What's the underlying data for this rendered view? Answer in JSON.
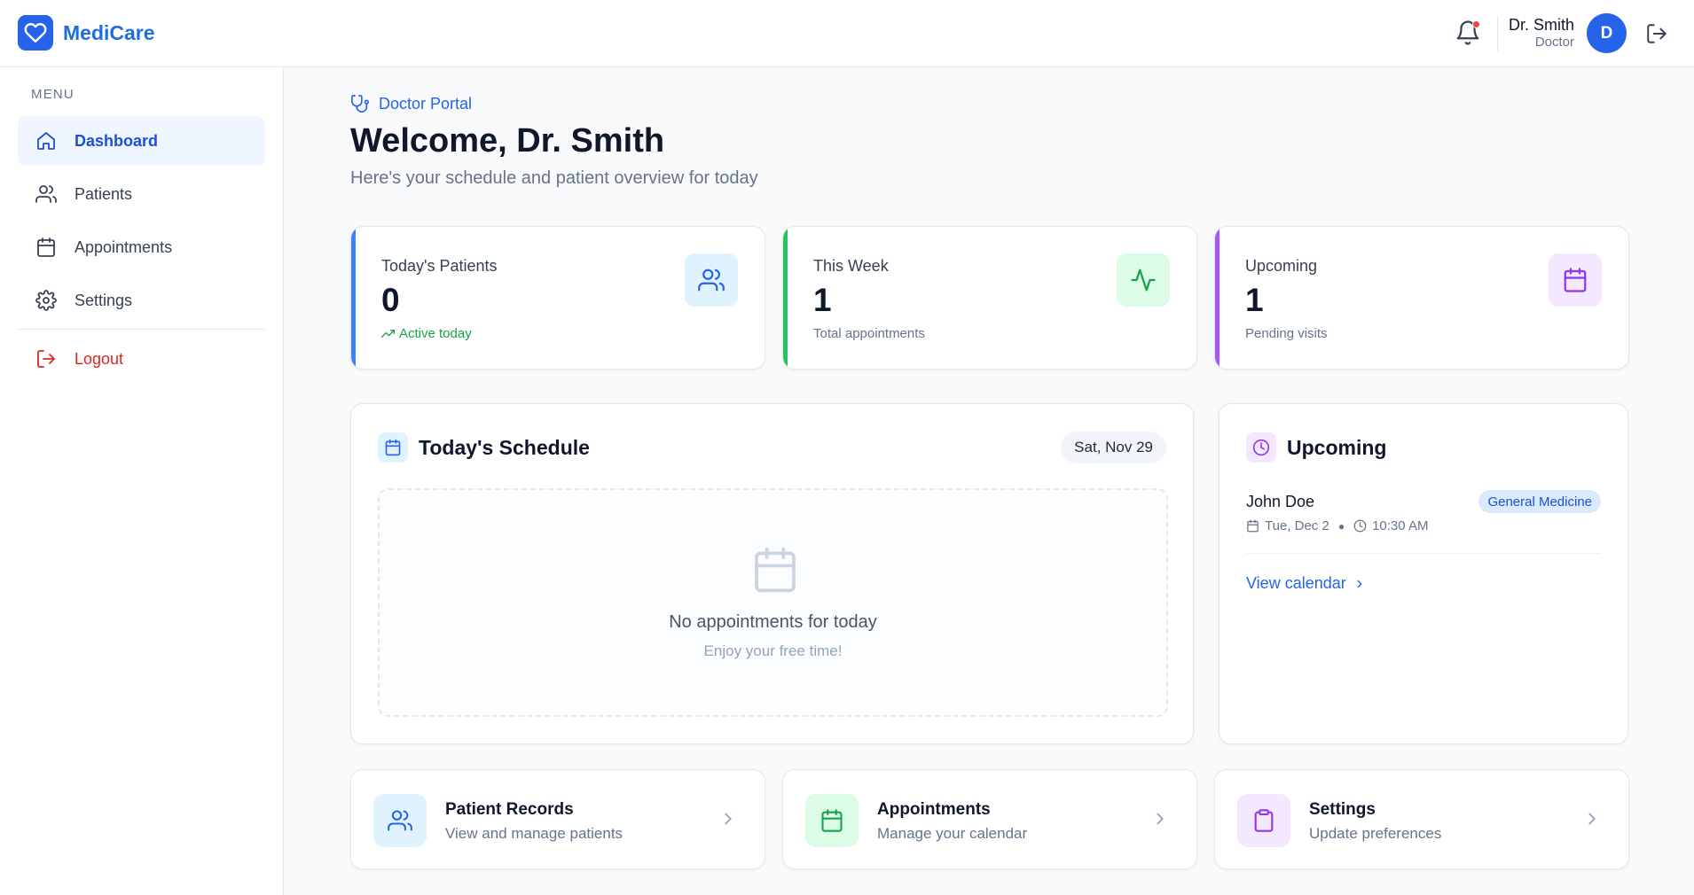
{
  "brand": {
    "name": "MediCare"
  },
  "header": {
    "user_name": "Dr. Smith",
    "user_role": "Doctor",
    "avatar_initial": "D"
  },
  "sidebar": {
    "menu_label": "MENU",
    "items": [
      {
        "label": "Dashboard",
        "icon": "home-icon",
        "active": true
      },
      {
        "label": "Patients",
        "icon": "users-icon"
      },
      {
        "label": "Appointments",
        "icon": "calendar-icon"
      },
      {
        "label": "Settings",
        "icon": "gear-icon"
      }
    ],
    "logout_label": "Logout"
  },
  "main": {
    "portal_label": "Doctor Portal",
    "welcome": "Welcome, Dr. Smith",
    "subtitle": "Here's your schedule and patient overview for today"
  },
  "stats": [
    {
      "label": "Today's Patients",
      "value": "0",
      "sub": "Active today",
      "accent": "#3b82f6",
      "icon": "users-icon"
    },
    {
      "label": "This Week",
      "value": "1",
      "sub": "Total appointments",
      "accent": "#22c55e",
      "icon": "activity-icon"
    },
    {
      "label": "Upcoming",
      "value": "1",
      "sub": "Pending visits",
      "accent": "#a855f7",
      "icon": "calendar-icon"
    }
  ],
  "schedule": {
    "title": "Today's Schedule",
    "date": "Sat, Nov 29",
    "empty_title": "No appointments for today",
    "empty_sub": "Enjoy your free time!"
  },
  "upcoming": {
    "title": "Upcoming",
    "appointments": [
      {
        "patient": "John Doe",
        "specialty": "General Medicine",
        "date": "Tue, Dec 2",
        "time": "10:30 AM"
      }
    ],
    "view_calendar": "View calendar"
  },
  "quick_links": [
    {
      "title": "Patient Records",
      "sub": "View and manage patients",
      "icon": "users-icon"
    },
    {
      "title": "Appointments",
      "sub": "Manage your calendar",
      "icon": "calendar-icon"
    },
    {
      "title": "Settings",
      "sub": "Update preferences",
      "icon": "clipboard-icon"
    }
  ],
  "colors": {
    "primary": "#2563eb",
    "green": "#22c55e",
    "purple": "#a855f7",
    "danger": "#dc2626"
  }
}
